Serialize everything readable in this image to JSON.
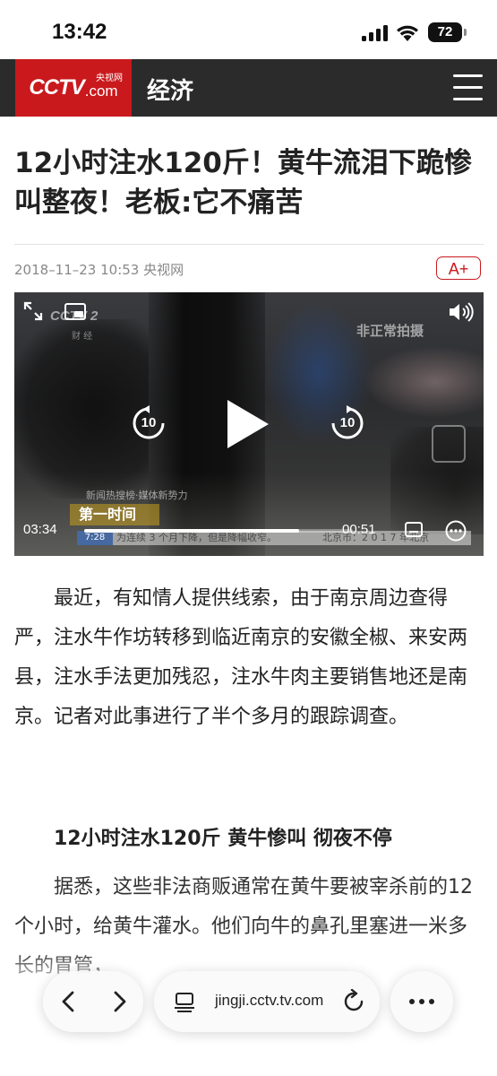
{
  "status_bar": {
    "time": "13:42",
    "battery": "72"
  },
  "header": {
    "logo_text": "CCTV",
    "logo_com": ".com",
    "logo_cn": "央视网",
    "section": "经济"
  },
  "article": {
    "title": "12小时注水120斤！黄牛流泪下跪惨叫整夜！老板:它不痛苦",
    "meta": "2018–11–23 10:53 央视网",
    "font_button": "A+",
    "video": {
      "watermark_left": "CCTV 2",
      "watermark_left_sub": "财 经",
      "watermark_right": "非正常拍摄",
      "news_caption": "新闻热搜榜·媒体新势力",
      "show_name": "第一时间",
      "ticker_time": "7:28",
      "ticker_text": "为连续 3 个月下降，但是降幅收窄。",
      "ticker_right": "北京市：2 0 1 7 年北京",
      "elapsed": "03:34",
      "remaining": "00:51",
      "progress": 0.8,
      "skip_back": "10",
      "skip_forward": "10"
    },
    "paragraph1": "最近，有知情人提供线索，由于南京周边查得严，注水牛作坊转移到临近南京的安徽全椒、来安两县，注水手法更加残忍，注水牛肉主要销售地还是南京。记者对此事进行了半个多月的跟踪调查。",
    "subheading": "12小时注水120斤 黄牛惨叫 彻夜不停",
    "paragraph2": "据悉，这些非法商贩通常在黄牛要被宰杀前的12个小时，给黄牛灌水。他们向牛的鼻孔里塞进一米多长的胃管，"
  },
  "browser": {
    "url": "jingji.cctv.tv.com"
  }
}
